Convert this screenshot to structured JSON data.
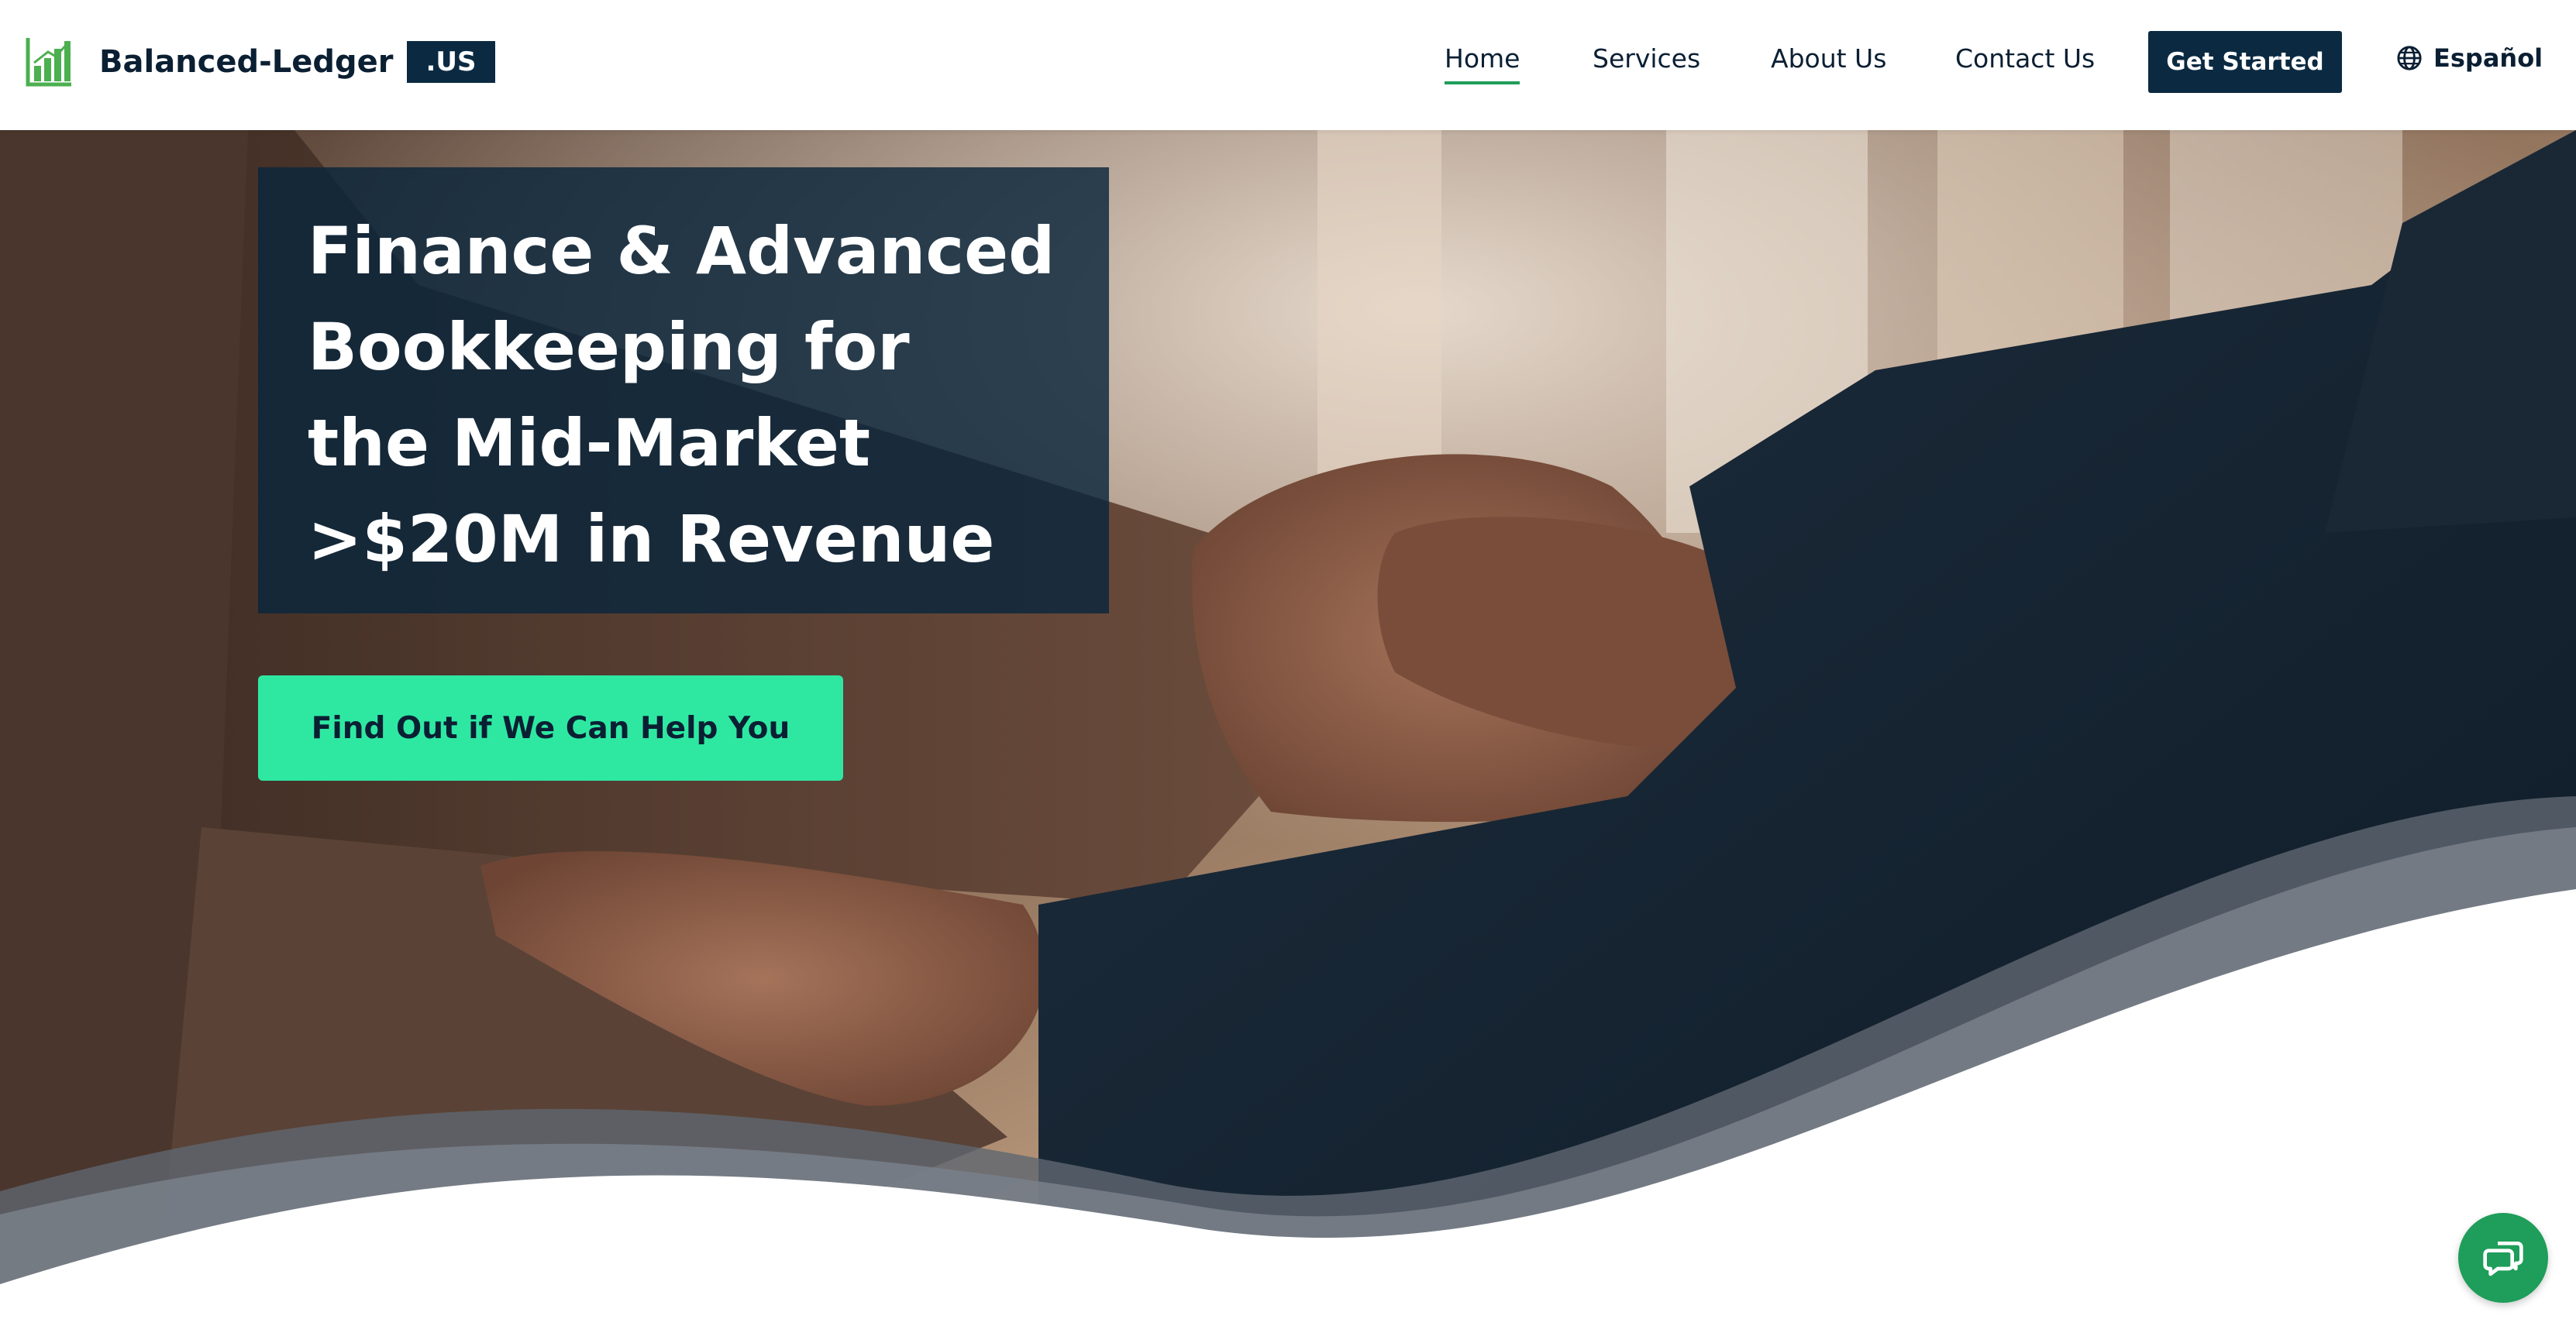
{
  "brand": {
    "name": "Balanced-Ledger",
    "tld": ".US",
    "logo_icon": "bar-chart-icon",
    "accent_color": "#1f9d5a",
    "navy_color": "#0b2a42",
    "mint_color": "#2ee8a2"
  },
  "nav": {
    "items": [
      {
        "label": "Home",
        "active": true
      },
      {
        "label": "Services",
        "active": false
      },
      {
        "label": "About Us",
        "active": false
      },
      {
        "label": "Contact Us",
        "active": false
      }
    ],
    "cta_label": "Get Started",
    "language_label": "Español",
    "language_icon": "globe-icon"
  },
  "hero": {
    "headline_lines": [
      "Finance & Advanced",
      "Bookkeeping for",
      "the Mid-Market",
      ">$20M in Revenue"
    ],
    "cta_label": "Find Out if We Can Help You",
    "background_subject": "handshake photo"
  },
  "chat": {
    "icon": "chat-bubbles-icon"
  }
}
